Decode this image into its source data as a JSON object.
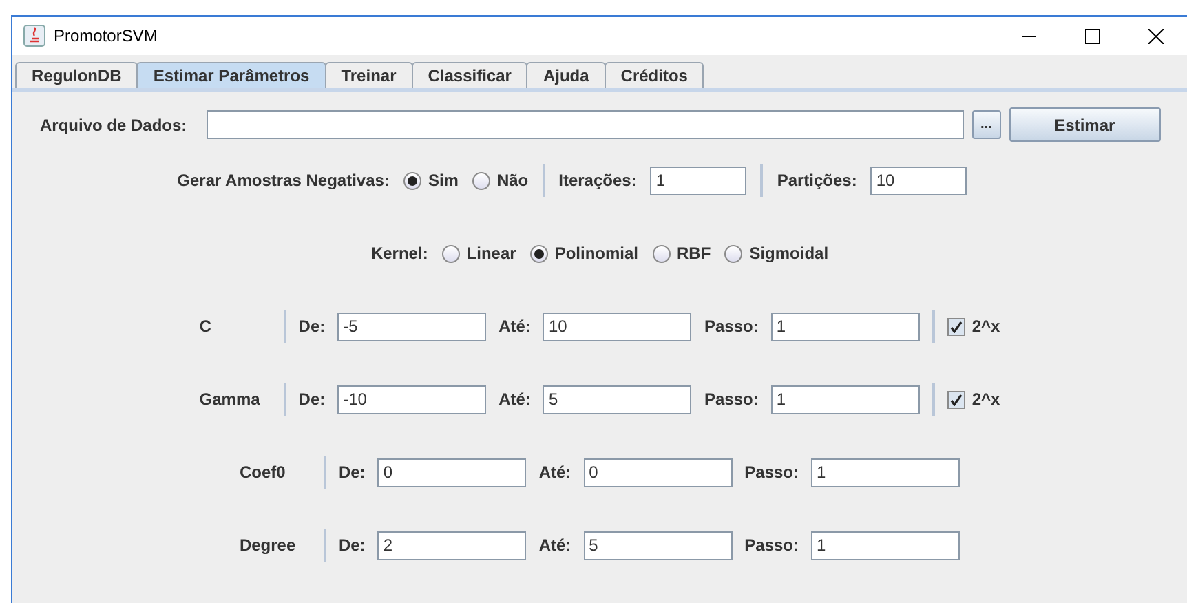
{
  "window": {
    "title": "PromotorSVM"
  },
  "tabs": [
    {
      "label": "RegulonDB",
      "selected": false
    },
    {
      "label": "Estimar Parâmetros",
      "selected": true
    },
    {
      "label": "Treinar",
      "selected": false
    },
    {
      "label": "Classificar",
      "selected": false
    },
    {
      "label": "Ajuda",
      "selected": false
    },
    {
      "label": "Créditos",
      "selected": false
    }
  ],
  "file": {
    "label": "Arquivo de Dados:",
    "browse": "...",
    "button": "Estimar"
  },
  "negatives": {
    "label": "Gerar Amostras Negativas:",
    "options": [
      {
        "label": "Sim",
        "selected": true
      },
      {
        "label": "Não",
        "selected": false
      }
    ],
    "iterations_label": "Iterações:",
    "iterations": "1",
    "partitions_label": "Partições:",
    "partitions": "10"
  },
  "kernel": {
    "label": "Kernel:",
    "options": [
      {
        "label": "Linear",
        "selected": false
      },
      {
        "label": "Polinomial",
        "selected": true
      },
      {
        "label": "RBF",
        "selected": false
      },
      {
        "label": "Sigmoidal",
        "selected": false
      }
    ]
  },
  "params": [
    {
      "name": "C",
      "from_label": "De:",
      "from": "-5",
      "to_label": "Até:",
      "to": "10",
      "step_label": "Passo:",
      "step": "1",
      "exp": {
        "label": "2^x",
        "checked": true
      }
    },
    {
      "name": "Gamma",
      "from_label": "De:",
      "from": "-10",
      "to_label": "Até:",
      "to": "5",
      "step_label": "Passo:",
      "step": "1",
      "exp": {
        "label": "2^x",
        "checked": true
      }
    },
    {
      "name": "Coef0",
      "from_label": "De:",
      "from": "0",
      "to_label": "Até:",
      "to": "0",
      "step_label": "Passo:",
      "step": "1"
    },
    {
      "name": "Degree",
      "from_label": "De:",
      "from": "2",
      "to_label": "Até:",
      "to": "5",
      "step_label": "Passo:",
      "step": "1"
    }
  ]
}
